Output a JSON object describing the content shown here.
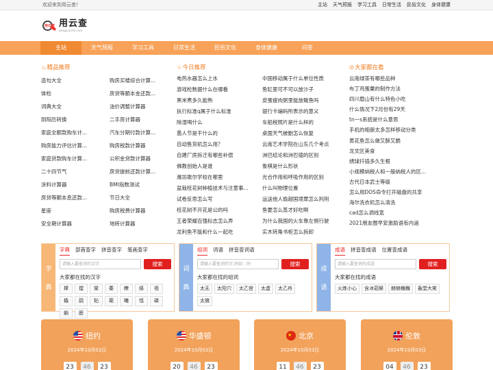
{
  "topbar": {
    "welcome": "欢迎来到用云查！",
    "links": [
      "主站",
      "天气预报",
      "学习工具",
      "日常生活",
      "民俗文化",
      "身体健康"
    ]
  },
  "logo": {
    "name": "用云查",
    "mark": "用云查",
    "domain": "yongyuncha.com"
  },
  "nav": {
    "items": [
      "主站",
      "天气预报",
      "学习工具",
      "日常生活",
      "民俗文化",
      "身体健康",
      "问答"
    ]
  },
  "featured": {
    "icon": "♨",
    "title": "精品推荐",
    "items": [
      "造句大全",
      "购房买楼综合计算...",
      "体检",
      "房贷等额本金还款...",
      "词典大全",
      "油价调整计算器",
      "阴阳历转换",
      "二手房计算器",
      "家庭全额款购车计...",
      "汽车分期付款计算...",
      "购房能力评估计算...",
      "购房税款计算器",
      "家庭贷款购车计算...",
      "公积金贷款计算器",
      "二十四节气",
      "房贷提前还款计算...",
      "涂料计算器",
      "BMI指数测试",
      "房贷等额本息还款...",
      "节日大全",
      "星座",
      "购房税费计算器",
      "安全期计算器",
      "地砖计算器"
    ]
  },
  "today": {
    "icon": "☆",
    "title": "今日推荐",
    "items": [
      "电热水器怎么上水",
      "中国移动属于什么单位性质",
      "游戏检数据什么在哪看",
      "鱼缸里可不可以放沙子",
      "黑米煮多久能熟",
      "皮蛋瘦肉粥里能放鲅鱼吗",
      "执行标准q属于什么标准",
      "银行卡编码所表示的意义",
      "除湿喝什么",
      "车船税照片是什么样的",
      "愚人节是干什么的",
      "桌面天气被删怎么恢复",
      "自动售货机怎么用？",
      "云南艺术学院在山东几个考点",
      "自建厂房拆迁有哪些补偿",
      "洲巴结论和洲巴德的区别",
      "佛教创始人是谁",
      "象棋是什么形状",
      "潍坊歌尔学校在哪里",
      "光合作用和呼吸作用的区别",
      "盆栽桂花树种植技术与注意事...",
      "什么叫物理位置",
      "试卷反思怎么写",
      "运送他人偷越国境罪怎么判刑",
      "桂花树不开花是公的吗",
      "鱼要怎么蒸才好吃啊",
      "王者荣耀百强标志怎么弄",
      "为什么我国的火车靠左侧行驶",
      "龙利鱼不能和什么一起吃",
      "实木转角书柜怎么拆卸"
    ]
  },
  "popular": {
    "icon": "⊙",
    "title": "大家都在看",
    "items": [
      "云南绿茶有哪些品种",
      "布丁鸡蛋羹的制作方法",
      "四川眉山有什么特色小吃",
      "什么情况下2月份有29天",
      "tn一s系统是什么意思",
      "手机的相册太多怎样移动分类",
      "黄花鱼怎么做又酥又脆",
      "龙文区美食",
      "绣球扦插多久生根",
      "小规模纳税人和一般纳税人的区...",
      "古代日本武士等级",
      "怎么用DOS命令打开磁盘的共享",
      "海尔洗衣机怎么清洗",
      "cad怎么调线宽",
      "2021朋友圈早安激励语有内涵"
    ]
  },
  "dict_char": {
    "side": [
      "字",
      "典"
    ],
    "tabs": [
      "字典",
      "部首查字",
      "拼音查字",
      "笔画查字"
    ],
    "placeholder": "请输入要查询的汉字",
    "button": "搜索",
    "subtitle": "大家都在找的汉字",
    "chips": [
      "撵",
      "镗",
      "棠",
      "蓁",
      "瞭",
      "绦",
      "祖",
      "橇",
      "鹞",
      "贴",
      "葩",
      "曦",
      "恬",
      "磷",
      "躺",
      "膀"
    ]
  },
  "dict_word": {
    "side": [
      "词",
      "典"
    ],
    "tabs": [
      "组词",
      "词语",
      "拼音查词语"
    ],
    "placeholder": "请输入要查询的字,例如：同",
    "button": "搜索",
    "subtitle": "大家都在找的组词",
    "chips": [
      "太无",
      "太阳穴",
      "太乙宫",
      "太虚",
      "太乙舟",
      "太微"
    ]
  },
  "dict_idiom": {
    "side": [
      "成",
      "语"
    ],
    "tabs": [
      "成语",
      "拼音查成语",
      "位置查成语"
    ],
    "placeholder": "请输入要查询的成语",
    "button": "搜索",
    "subtitle": "大家都在找的成语",
    "chips": [
      "火炼小心",
      "含冰茹檗",
      "赫赫巍巍",
      "轰堂大笑"
    ]
  },
  "clocks": [
    {
      "city": "纽约",
      "flag": "us-flag-icon",
      "date": "2024年10月02日",
      "digits": [
        "23",
        "46",
        "23"
      ]
    },
    {
      "city": "华盛顿",
      "flag": "us-flag-icon",
      "date": "2024年10月02日",
      "digits": [
        "20",
        "46",
        "23"
      ]
    },
    {
      "city": "北京",
      "flag": "cn-flag-icon",
      "date": "2024年10月03日",
      "digits": [
        "11",
        "46",
        "23"
      ]
    },
    {
      "city": "伦敦",
      "flag": "uk-flag-icon",
      "date": "2024年10月03日",
      "digits": [
        "04",
        "46",
        "23"
      ]
    }
  ],
  "colors": {
    "nav": "#f7a258",
    "nav_active": "#f08a32",
    "accent": "#f07b1e",
    "search_button": "#e0201f",
    "clock_card": "#f2a25b",
    "dict_side_orange": "#f7b777",
    "dict_side_blue": "#8fb4e8"
  }
}
